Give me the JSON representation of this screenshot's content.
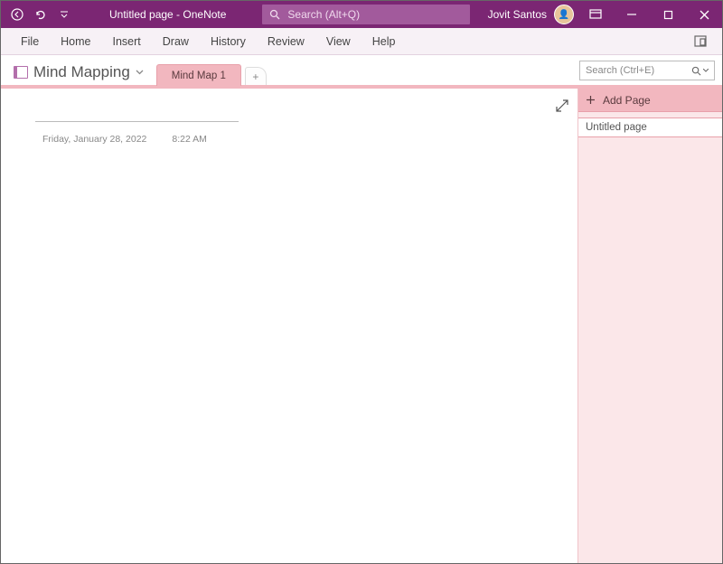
{
  "titlebar": {
    "title_full": "Untitled page  -  OneNote",
    "search_placeholder": "Search (Alt+Q)",
    "user_name": "Jovit Santos"
  },
  "ribbon": {
    "items": [
      "File",
      "Home",
      "Insert",
      "Draw",
      "History",
      "Review",
      "View",
      "Help"
    ]
  },
  "notebook": {
    "name": "Mind Mapping",
    "tabs": [
      {
        "label": "Mind Map 1"
      }
    ],
    "search_placeholder": "Search (Ctrl+E)"
  },
  "page": {
    "date": "Friday, January 28, 2022",
    "time": "8:22 AM"
  },
  "pages_panel": {
    "add_label": "Add Page",
    "items": [
      {
        "label": "Untitled page"
      }
    ]
  }
}
